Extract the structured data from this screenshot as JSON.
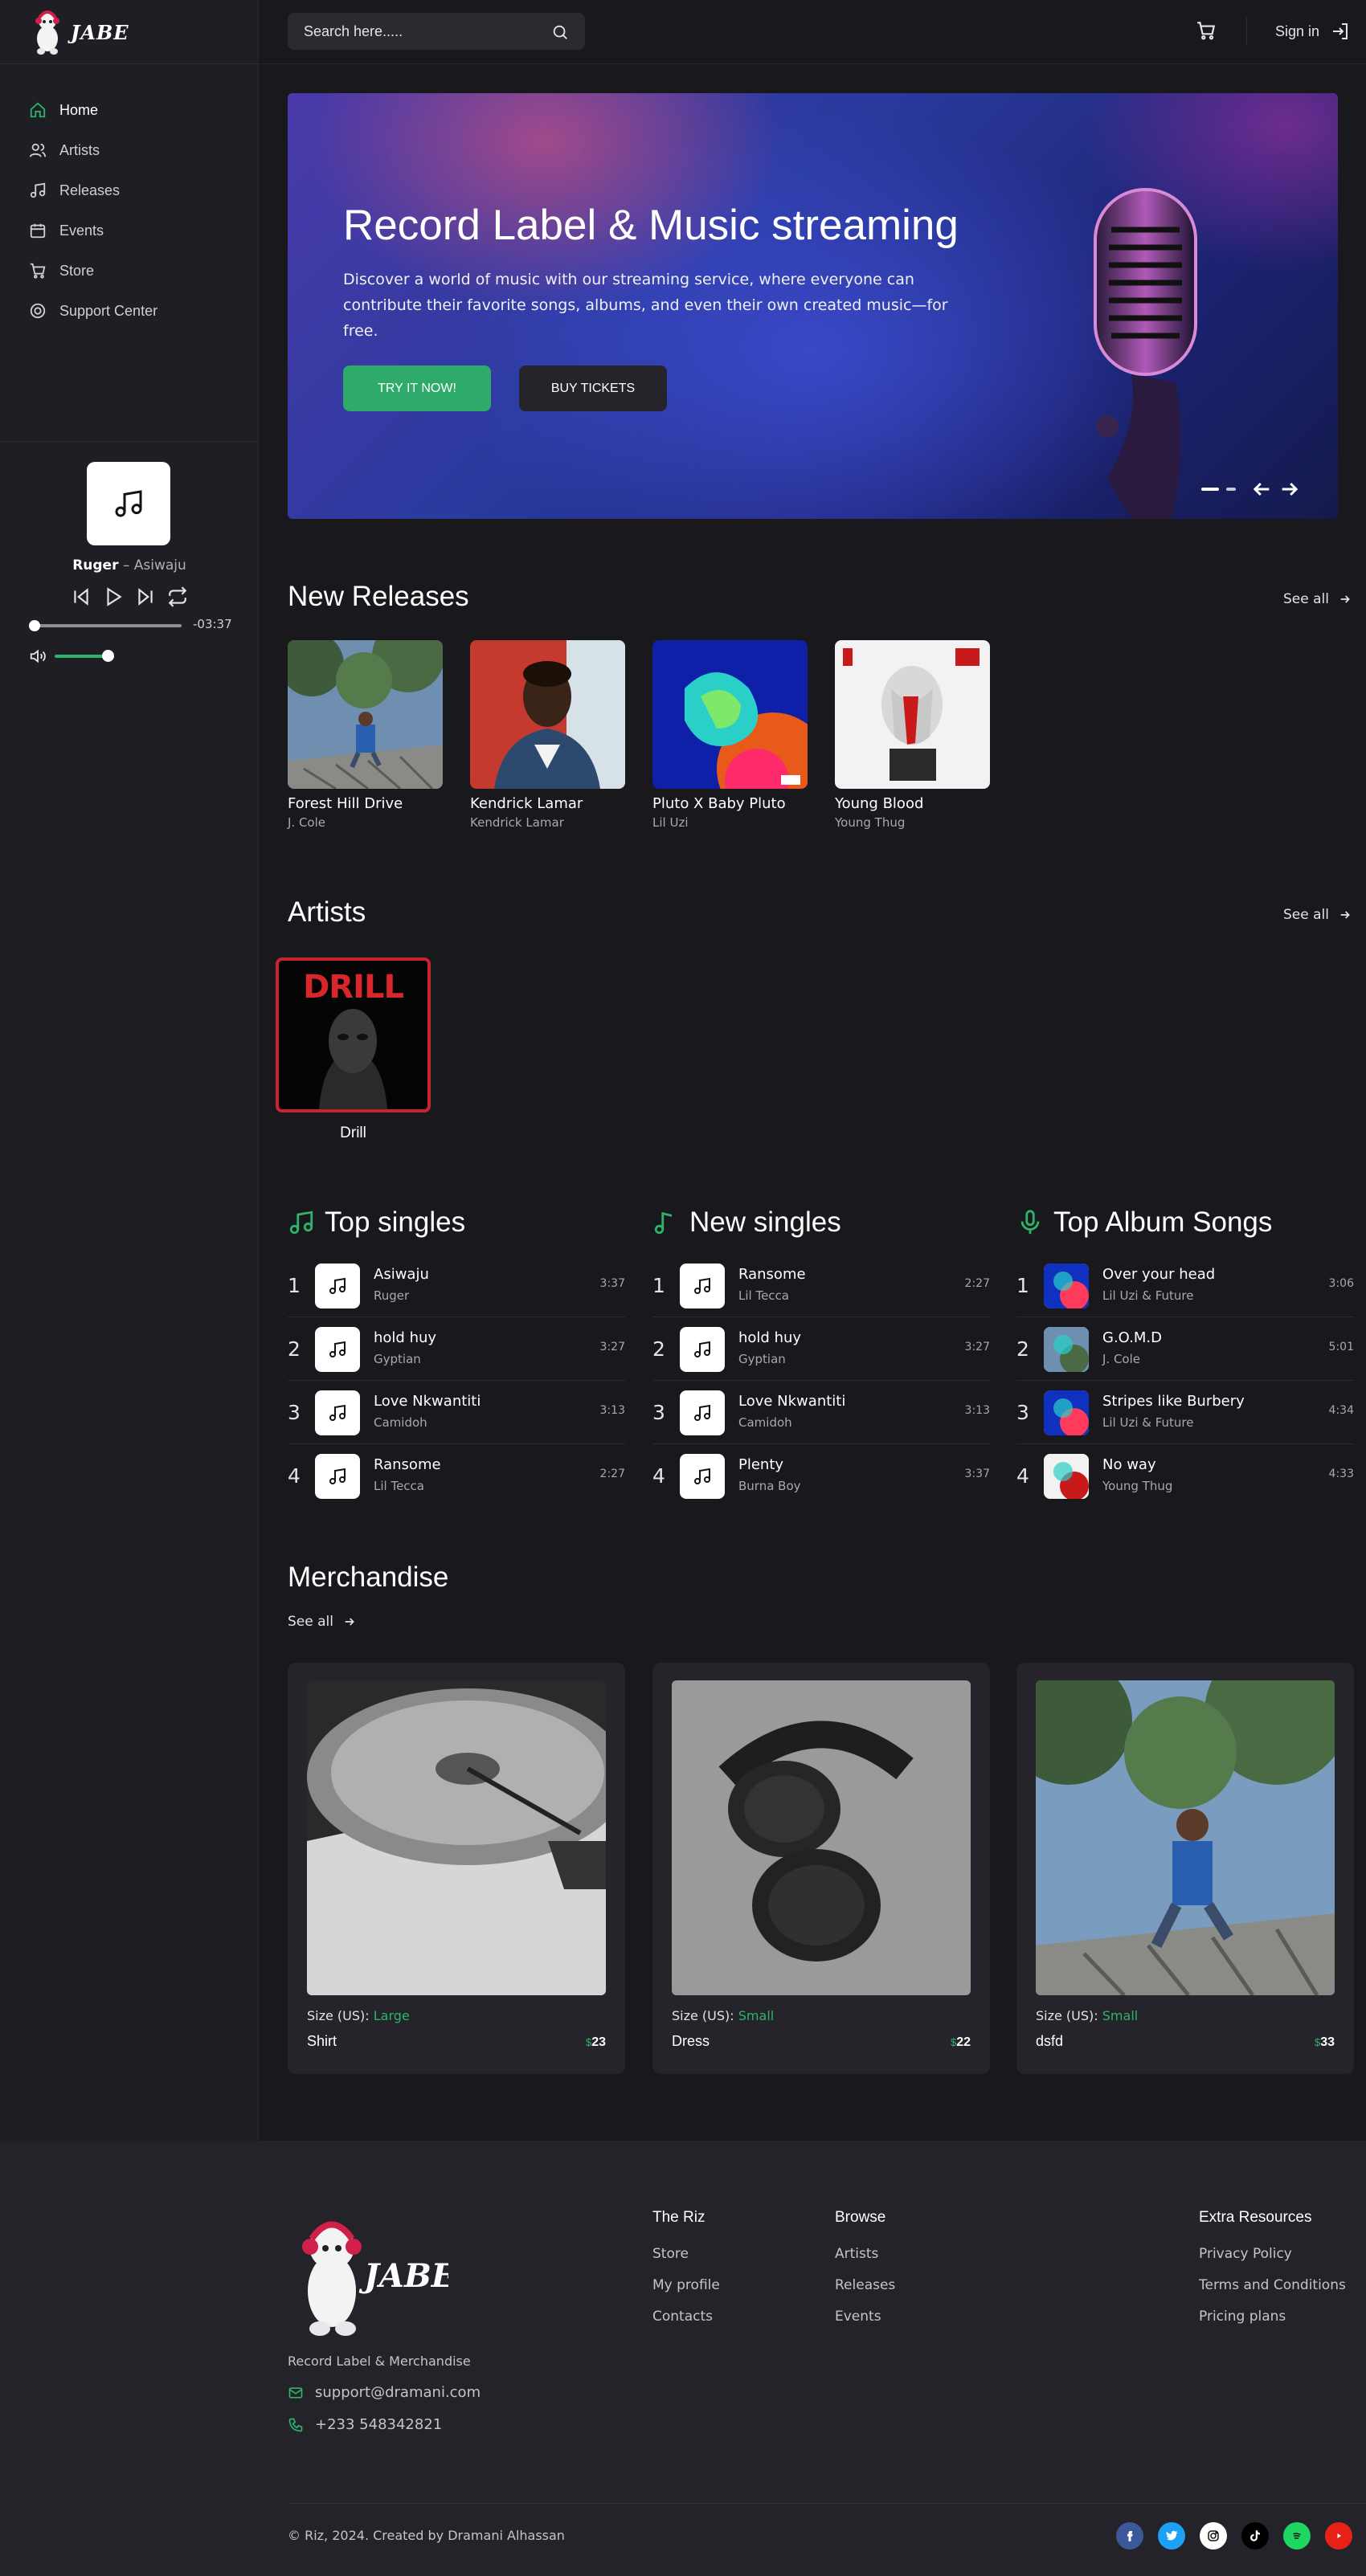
{
  "brand": {
    "name": "JABE"
  },
  "search": {
    "placeholder": "Search here....."
  },
  "header": {
    "signin_label": "Sign in"
  },
  "sidebar": {
    "items": [
      {
        "label": "Home",
        "icon": "home-icon"
      },
      {
        "label": "Artists",
        "icon": "users-icon"
      },
      {
        "label": "Releases",
        "icon": "music-note-icon"
      },
      {
        "label": "Events",
        "icon": "calendar-icon"
      },
      {
        "label": "Store",
        "icon": "cart-icon"
      },
      {
        "label": "Support Center",
        "icon": "support-icon"
      }
    ]
  },
  "player": {
    "artist": "Ruger",
    "separator": " – ",
    "song": "Asiwaju",
    "time_remaining": "-03:37",
    "progress": 0.0,
    "volume": 0.75
  },
  "hero": {
    "title": "Record Label & Music streaming",
    "description": "Discover a world of music with our streaming service, where everyone can contribute their favorite songs, albums, and even their own created music—for free.",
    "try_label": "TRY IT NOW!",
    "buy_label": "BUY TICKETS"
  },
  "new_releases": {
    "title": "New Releases",
    "see_all": "See all",
    "items": [
      {
        "title": "Forest Hill Drive",
        "artist": "J. Cole"
      },
      {
        "title": "Kendrick Lamar",
        "artist": "Kendrick Lamar"
      },
      {
        "title": "Pluto X Baby Pluto",
        "artist": "Lil Uzi"
      },
      {
        "title": "Young Blood",
        "artist": "Young Thug"
      }
    ]
  },
  "artists": {
    "title": "Artists",
    "see_all": "See all",
    "items": [
      {
        "name": "Drill",
        "cover_text": "DRILL"
      }
    ]
  },
  "top_singles": {
    "title": "Top singles",
    "tracks": [
      {
        "num": "1",
        "title": "Asiwaju",
        "artist": "Ruger",
        "duration": "3:37"
      },
      {
        "num": "2",
        "title": "hold huy",
        "artist": "Gyptian",
        "duration": "3:27"
      },
      {
        "num": "3",
        "title": "Love Nkwantiti",
        "artist": "Camidoh",
        "duration": "3:13"
      },
      {
        "num": "4",
        "title": "Ransome",
        "artist": "Lil Tecca",
        "duration": "2:27"
      }
    ]
  },
  "new_singles": {
    "title": "New singles",
    "tracks": [
      {
        "num": "1",
        "title": "Ransome",
        "artist": "Lil Tecca",
        "duration": "2:27"
      },
      {
        "num": "2",
        "title": "hold huy",
        "artist": "Gyptian",
        "duration": "3:27"
      },
      {
        "num": "3",
        "title": "Love Nkwantiti",
        "artist": "Camidoh",
        "duration": "3:13"
      },
      {
        "num": "4",
        "title": "Plenty",
        "artist": "Burna Boy",
        "duration": "3:37"
      }
    ]
  },
  "top_album_songs": {
    "title": "Top Album Songs",
    "tracks": [
      {
        "num": "1",
        "title": "Over your head",
        "artist": "Lil Uzi & Future",
        "duration": "3:06"
      },
      {
        "num": "2",
        "title": "G.O.M.D",
        "artist": "J. Cole",
        "duration": "5:01"
      },
      {
        "num": "3",
        "title": "Stripes like Burbery",
        "artist": "Lil Uzi & Future",
        "duration": "4:34"
      },
      {
        "num": "4",
        "title": "No way",
        "artist": "Young Thug",
        "duration": "4:33"
      }
    ]
  },
  "merchandise": {
    "title": "Merchandise",
    "see_all": "See all",
    "size_label": "Size (US):",
    "currency": "$",
    "items": [
      {
        "size": "Large",
        "name": "Shirt",
        "price": "23"
      },
      {
        "size": "Small",
        "name": "Dress",
        "price": "22"
      },
      {
        "size": "Small",
        "name": "dsfd",
        "price": "33"
      }
    ]
  },
  "footer": {
    "tagline": "Record Label & Merchandise",
    "email": "support@dramani.com",
    "phone": "+233 548342821",
    "columns": [
      {
        "title": "The Riz",
        "links": [
          "Store",
          "My profile",
          "Contacts"
        ]
      },
      {
        "title": "Browse",
        "links": [
          "Artists",
          "Releases",
          "Events"
        ]
      },
      {
        "title": "Extra Resources",
        "links": [
          "Privacy Policy",
          "Terms and Conditions",
          "Pricing plans"
        ]
      }
    ],
    "copyright": "© Riz, 2024. Created by Dramani Alhassan",
    "social": [
      {
        "name": "facebook-icon",
        "color": "#3b5998"
      },
      {
        "name": "twitter-icon",
        "color": "#1da1f2"
      },
      {
        "name": "instagram-icon",
        "color": "#ffffff"
      },
      {
        "name": "tiktok-icon",
        "color": "#000000"
      },
      {
        "name": "spotify-icon",
        "color": "#1ed760"
      },
      {
        "name": "youtube-icon",
        "color": "#e62117"
      }
    ]
  },
  "colors": {
    "accent": "#2eaa6b",
    "background": "#19181c",
    "sidebar": "#1f1e24",
    "card": "#25242a"
  }
}
